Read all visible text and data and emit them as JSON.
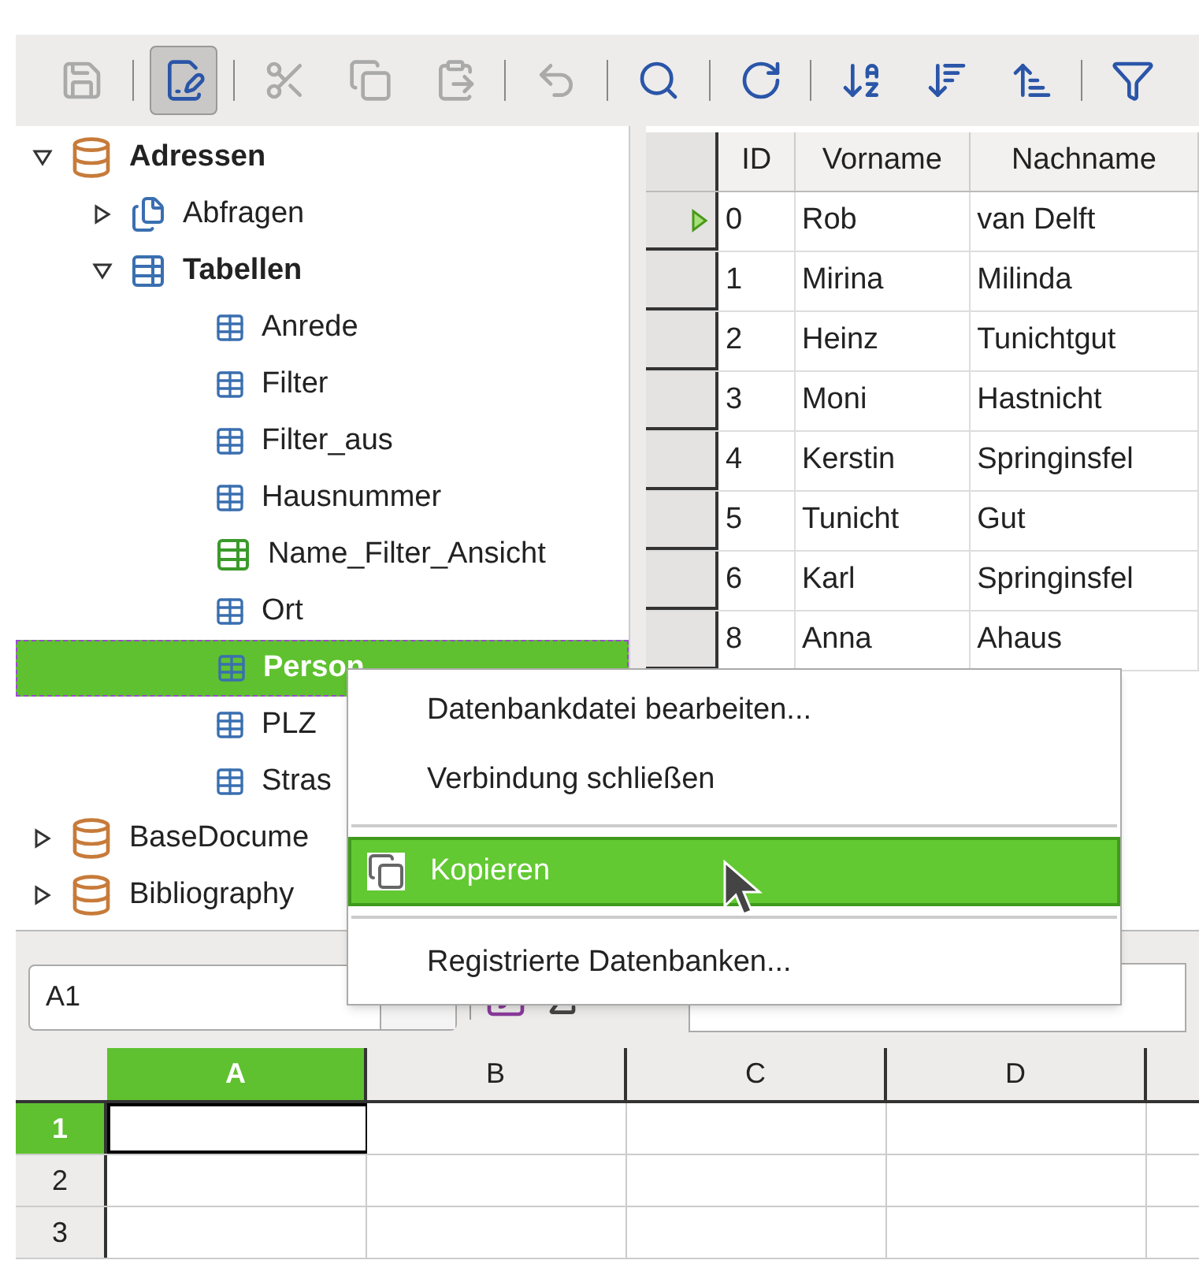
{
  "toolbar": {
    "groups": [
      [
        {
          "disabled": true,
          "pressed": false
        }
      ],
      [
        {
          "disabled": false,
          "pressed": true
        }
      ],
      [
        {
          "disabled": true,
          "pressed": false
        },
        {
          "disabled": true,
          "pressed": false
        },
        {
          "disabled": true,
          "pressed": false
        }
      ],
      [
        {
          "disabled": true,
          "pressed": false
        }
      ],
      [
        {
          "disabled": false,
          "pressed": false
        }
      ],
      [
        {
          "disabled": false,
          "pressed": false
        }
      ],
      [
        {
          "disabled": false,
          "pressed": false
        },
        {
          "disabled": false,
          "pressed": false
        },
        {
          "disabled": false,
          "pressed": false
        }
      ],
      [
        {
          "disabled": false,
          "pressed": false
        }
      ]
    ]
  },
  "tree": [
    {
      "label": "Adressen",
      "kind": "database",
      "expanded": true,
      "selected": false,
      "children": [
        {
          "label": "Abfragen",
          "kind": "queries",
          "expanded": false,
          "selected": false
        },
        {
          "label": "Tabellen",
          "kind": "tables",
          "expanded": true,
          "selected": false,
          "children": [
            {
              "label": "Anrede",
              "kind": "table",
              "selected": false
            },
            {
              "label": "Filter",
              "kind": "table",
              "selected": false
            },
            {
              "label": "Filter_aus",
              "kind": "table",
              "selected": false
            },
            {
              "label": "Hausnummer",
              "kind": "table",
              "selected": false
            },
            {
              "label": "Name_Filter_Ansicht",
              "kind": "view",
              "selected": false
            },
            {
              "label": "Ort",
              "kind": "table",
              "selected": false
            },
            {
              "label": "Person",
              "kind": "table",
              "selected": true
            },
            {
              "label": "PLZ",
              "kind": "table",
              "selected": false
            },
            {
              "label": "Stras",
              "kind": "table",
              "selected": false
            }
          ]
        }
      ]
    },
    {
      "label": "BaseDocume",
      "kind": "database",
      "expanded": false,
      "selected": false
    },
    {
      "label": "Bibliography",
      "kind": "database",
      "expanded": false,
      "selected": false
    }
  ],
  "table": {
    "columns": [
      "ID",
      "Vorname",
      "Nachname"
    ],
    "rows": [
      {
        "current": true,
        "cells": [
          "0",
          "Rob",
          "van Delft"
        ]
      },
      {
        "current": false,
        "cells": [
          "1",
          "Mirina",
          "Milinda"
        ]
      },
      {
        "current": false,
        "cells": [
          "2",
          "Heinz",
          "Tunichtgut"
        ]
      },
      {
        "current": false,
        "cells": [
          "3",
          "Moni",
          "Hastnicht"
        ]
      },
      {
        "current": false,
        "cells": [
          "4",
          "Kerstin",
          "Springinsfel"
        ]
      },
      {
        "current": false,
        "cells": [
          "5",
          "Tunicht",
          "Gut"
        ]
      },
      {
        "current": false,
        "cells": [
          "6",
          "Karl",
          "Springinsfel"
        ]
      },
      {
        "current": false,
        "cells": [
          "8",
          "Anna",
          "Ahaus"
        ]
      }
    ]
  },
  "context_menu": [
    {
      "kind": "item",
      "label": "Datenbankdatei bearbeiten...",
      "selected": false,
      "icon": false
    },
    {
      "kind": "item",
      "label": "Verbindung schließen",
      "selected": false,
      "icon": false
    },
    {
      "kind": "separator"
    },
    {
      "kind": "item",
      "label": "Kopieren",
      "selected": true,
      "icon": true
    },
    {
      "kind": "separator"
    },
    {
      "kind": "item",
      "label": "Registrierte Datenbanken...",
      "selected": false,
      "icon": false
    }
  ],
  "formula_bar": {
    "name_box": "A1"
  },
  "sheet": {
    "columns": [
      {
        "label": "A",
        "selected": true
      },
      {
        "label": "B",
        "selected": false
      },
      {
        "label": "C",
        "selected": false
      },
      {
        "label": "D",
        "selected": false
      }
    ],
    "rows": [
      {
        "label": "1",
        "selected": true
      },
      {
        "label": "2",
        "selected": false
      },
      {
        "label": "3",
        "selected": false
      }
    ]
  }
}
